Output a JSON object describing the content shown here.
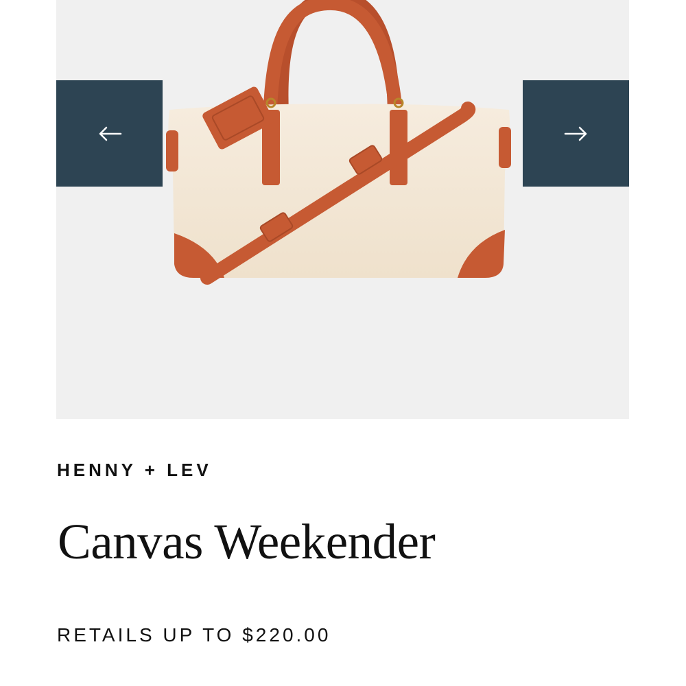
{
  "product": {
    "brand": "HENNY + LEV",
    "title": "Canvas Weekender",
    "price_text": "RETAILS UP TO $220.00"
  },
  "gallery": {
    "prev_icon": "arrow-left-icon",
    "next_icon": "arrow-right-icon",
    "background": "#f0f0f0",
    "button_color": "#2d4453"
  },
  "colors": {
    "canvas": "#f4e8d8",
    "leather": "#c65a33"
  }
}
